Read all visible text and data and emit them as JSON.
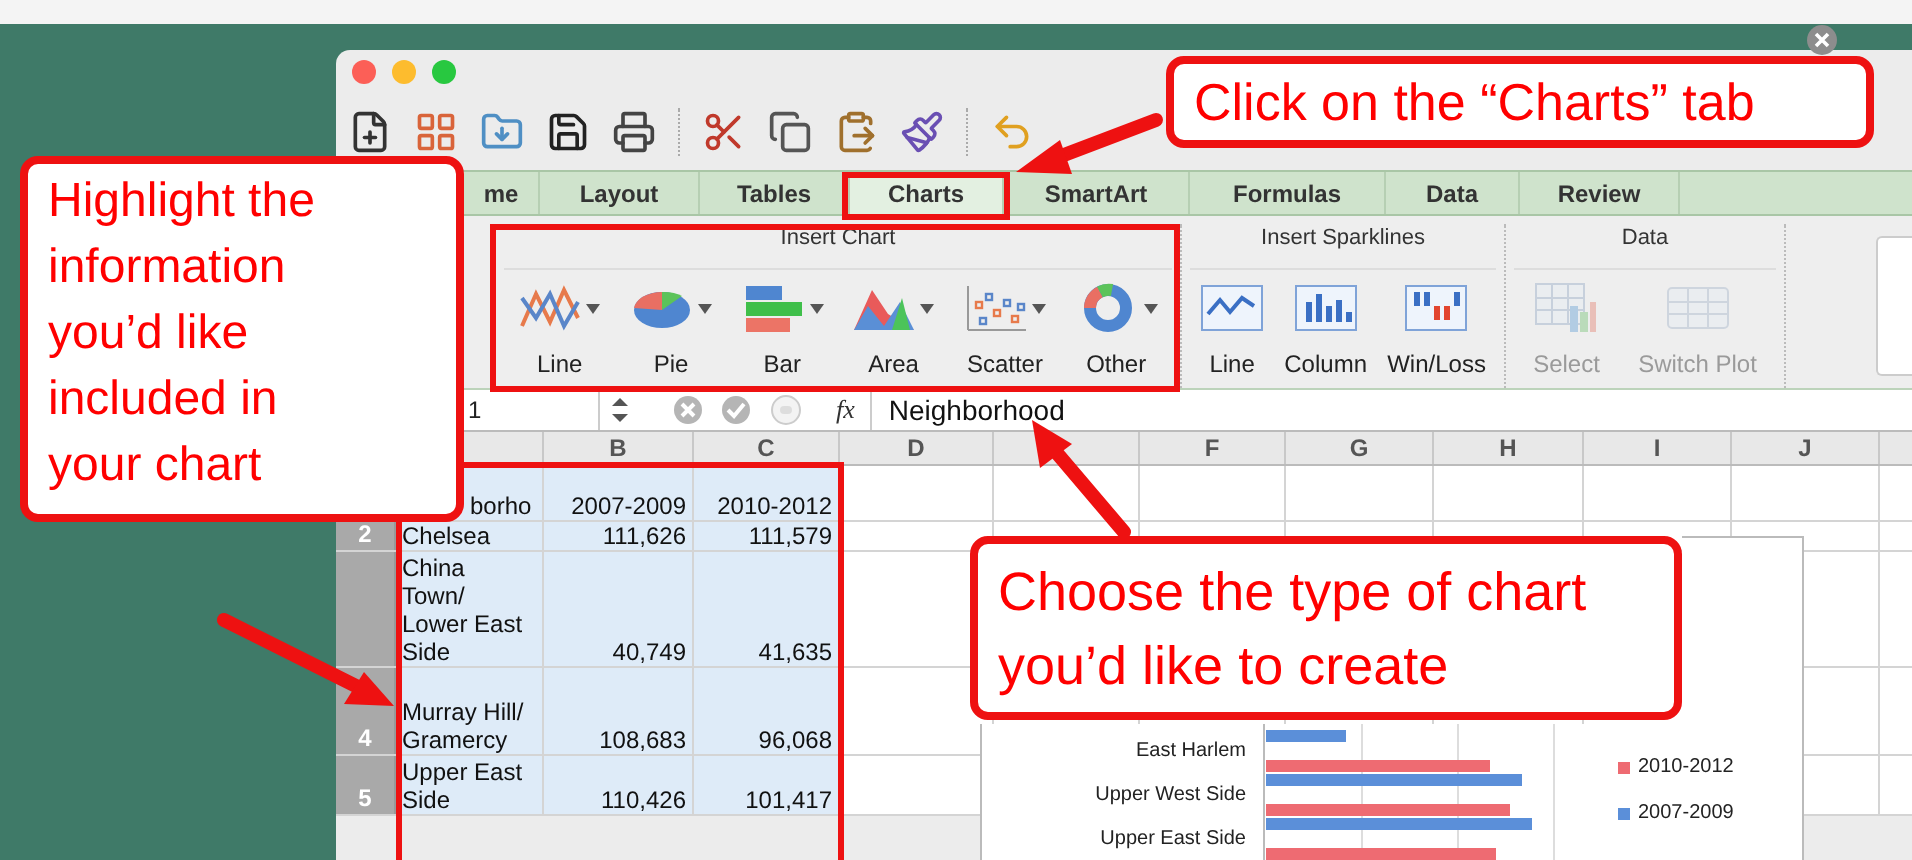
{
  "tabs": [
    {
      "label": "me",
      "selected": false
    },
    {
      "label": "Layout",
      "selected": false
    },
    {
      "label": "Tables",
      "selected": false
    },
    {
      "label": "Charts",
      "selected": true
    },
    {
      "label": "SmartArt",
      "selected": false
    },
    {
      "label": "Formulas",
      "selected": false
    },
    {
      "label": "Data",
      "selected": false
    },
    {
      "label": "Review",
      "selected": false
    }
  ],
  "ribbon": {
    "groups": [
      {
        "title": "Insert Chart",
        "buttons": [
          {
            "label": "Line",
            "kind": "line",
            "dropdown": true,
            "disabled": false
          },
          {
            "label": "Pie",
            "kind": "pie",
            "dropdown": true,
            "disabled": false
          },
          {
            "label": "Bar",
            "kind": "bar",
            "dropdown": true,
            "disabled": false
          },
          {
            "label": "Area",
            "kind": "area",
            "dropdown": true,
            "disabled": false
          },
          {
            "label": "Scatter",
            "kind": "scatter",
            "dropdown": true,
            "disabled": false
          },
          {
            "label": "Other",
            "kind": "donut",
            "dropdown": true,
            "disabled": false
          }
        ]
      },
      {
        "title": "Insert Sparklines",
        "buttons": [
          {
            "label": "Line",
            "kind": "sparkline",
            "dropdown": false,
            "disabled": false
          },
          {
            "label": "Column",
            "kind": "column",
            "dropdown": false,
            "disabled": false
          },
          {
            "label": "Win/Loss",
            "kind": "winloss",
            "dropdown": false,
            "disabled": false
          }
        ]
      },
      {
        "title": "Data",
        "buttons": [
          {
            "label": "Select",
            "kind": "select",
            "dropdown": false,
            "disabled": true
          },
          {
            "label": "Switch Plot",
            "kind": "switch",
            "dropdown": false,
            "disabled": true
          }
        ]
      }
    ]
  },
  "formula_bar": {
    "name_box": "1",
    "function_label": "fx",
    "formula": "Neighborhood"
  },
  "sheet": {
    "columns": [
      {},
      {
        "label": "B"
      },
      {
        "label": "C"
      },
      {
        "label": "D"
      },
      {},
      {
        "label": "F"
      },
      {
        "label": "G"
      },
      {
        "label": "H"
      },
      {
        "label": "I"
      },
      {
        "label": "J"
      }
    ],
    "rows": [
      {
        "cells": [
          {
            "text": "borho\n ",
            "selected": true
          },
          {
            "text": "2007-2009",
            "selected": true
          },
          {
            "text": "2010-2012",
            "selected": true
          }
        ]
      },
      {
        "header": "2",
        "cells": [
          {
            "text": "Chelsea",
            "selected": true
          },
          {
            "text": "111,626",
            "selected": true
          },
          {
            "text": "111,579",
            "selected": true
          }
        ]
      },
      {
        "cells": [
          {
            "text": "China\nTown/\nLower East\nSide",
            "selected": true
          },
          {
            "text": "40,749",
            "selected": true
          },
          {
            "text": "41,635",
            "selected": true
          }
        ]
      },
      {
        "header": "4",
        "cells": [
          {
            "text": "\nMurray Hill/\nGramercy",
            "selected": true
          },
          {
            "text": "108,683",
            "selected": true
          },
          {
            "text": "96,068",
            "selected": true
          }
        ]
      },
      {
        "header": "5",
        "cells": [
          {
            "text": "Upper East\nSide",
            "selected": true
          },
          {
            "text": "110,426",
            "selected": true
          },
          {
            "text": "101,417",
            "selected": true
          }
        ]
      }
    ]
  },
  "chart": {
    "categories": [
      "East Harlem",
      "Upper West Side",
      "Upper East Side"
    ],
    "legend": [
      {
        "label": "2010-2012",
        "color": "#ee6b72"
      },
      {
        "label": "2007-2009",
        "color": "#5b8fd9"
      }
    ]
  },
  "callouts": [
    {
      "text": "Click on the “Charts” tab"
    },
    {
      "text": "Highlight the information you’d like included in your chart"
    },
    {
      "text": "Choose the type of chart you’d like to create"
    }
  ]
}
